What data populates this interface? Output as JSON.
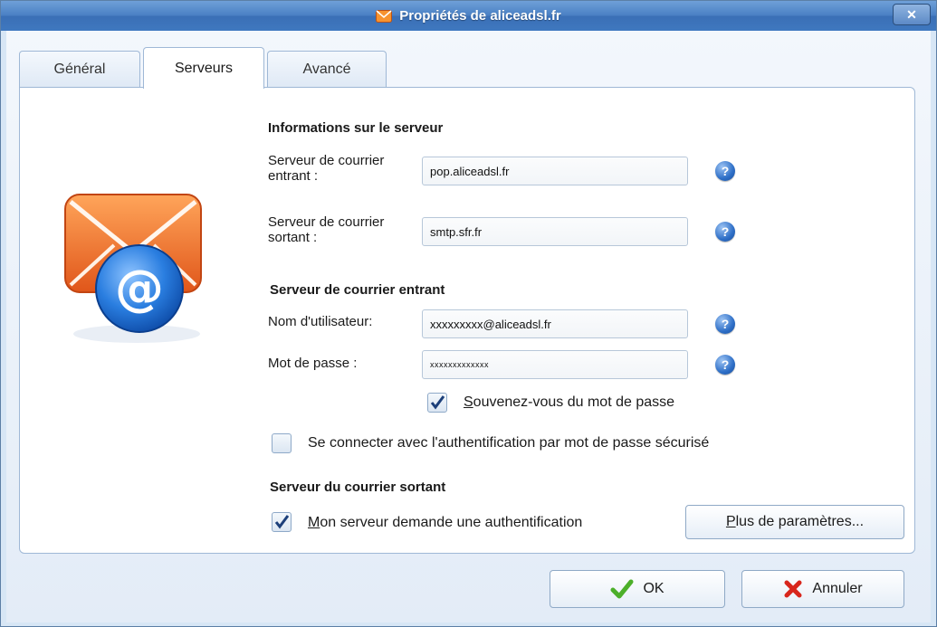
{
  "window": {
    "title": "Propriétés de aliceadsl.fr",
    "close_glyph": "✕"
  },
  "tabs": [
    {
      "label": "Général"
    },
    {
      "label": "Serveurs"
    },
    {
      "label": "Avancé"
    }
  ],
  "server_info": {
    "title": "Informations sur le serveur",
    "incoming_label_line1": "Serveur de courrier",
    "incoming_label_line2": "entrant :",
    "incoming_value": "pop.aliceadsl.fr",
    "outgoing_label_line1": "Serveur de courrier",
    "outgoing_label_line2": "sortant :",
    "outgoing_value": "smtp.sfr.fr"
  },
  "incoming_server": {
    "title": "Serveur de courrier entrant",
    "username_label": "Nom d'utilisateur:",
    "username_value": "xxxxxxxxx@aliceadsl.fr",
    "password_label": "Mot de passe :",
    "password_value": "xxxxxxxxxxxxx",
    "remember_prefix": "S",
    "remember_rest": "ouvenez-vous du mot de passe",
    "remember_checked": true,
    "spa_label": "Se connecter avec l'authentification par mot de passe sécurisé",
    "spa_checked": false
  },
  "outgoing_server": {
    "title": "Serveur du courrier sortant",
    "auth_prefix": "M",
    "auth_rest": "on serveur demande une authentification",
    "auth_checked": true,
    "more_prefix": "P",
    "more_rest": "lus de paramètres..."
  },
  "buttons": {
    "ok": "OK",
    "cancel": "Annuler"
  },
  "help_glyph": "?",
  "icons": {
    "title": "envelope-icon",
    "help": "help-icon",
    "ok": "checkmark-icon",
    "cancel": "red-x-icon",
    "main": "email-at-envelope-icon"
  },
  "colors": {
    "titlebar": "#4a80c4",
    "accent": "#2e6fc7",
    "ok_green": "#4caf2a",
    "cancel_red": "#d8261c",
    "envelope_orange": "#f07a2a"
  }
}
